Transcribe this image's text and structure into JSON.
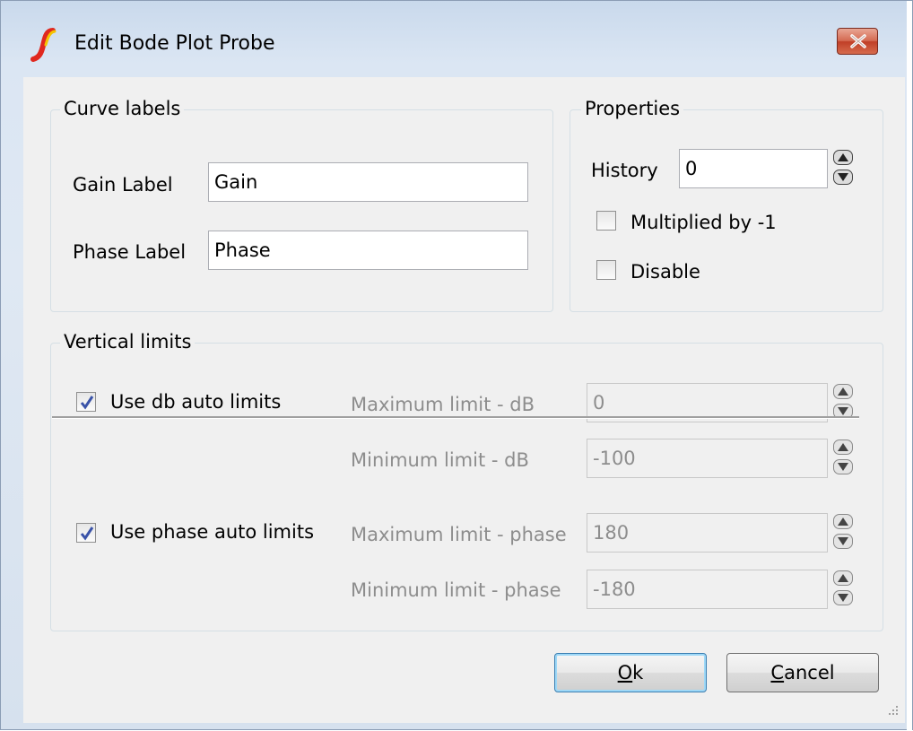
{
  "window": {
    "title": "Edit Bode Plot Probe",
    "app_icon": "simetrix-logo-icon",
    "close_icon": "close-x-icon"
  },
  "curve_labels": {
    "title": "Curve labels",
    "gain_label": "Gain Label",
    "gain_value": "Gain",
    "phase_label": "Phase Label",
    "phase_value": "Phase"
  },
  "properties": {
    "title": "Properties",
    "history_label": "History",
    "history_value": "0",
    "multiplied_label": "Multiplied by -1",
    "multiplied_checked": false,
    "disable_label": "Disable",
    "disable_checked": false
  },
  "vertical_limits": {
    "title": "Vertical limits",
    "use_db_label": "Use db auto limits",
    "use_db_checked": true,
    "max_db_label": "Maximum limit - dB",
    "max_db_value": "0",
    "min_db_label": "Minimum limit - dB",
    "min_db_value": "-100",
    "use_phase_label": "Use phase auto limits",
    "use_phase_checked": true,
    "max_phase_label": "Maximum limit - phase",
    "max_phase_value": "180",
    "min_phase_label": "Minimum limit - phase",
    "min_phase_value": "-180"
  },
  "buttons": {
    "ok_mnemonic": "O",
    "ok_rest": "k",
    "cancel_mnemonic": "C",
    "cancel_rest": "ancel"
  },
  "colors": {
    "check_mark": "#3a53a8",
    "close_button": "#c8472f",
    "default_button_border": "#3c7fb1"
  }
}
